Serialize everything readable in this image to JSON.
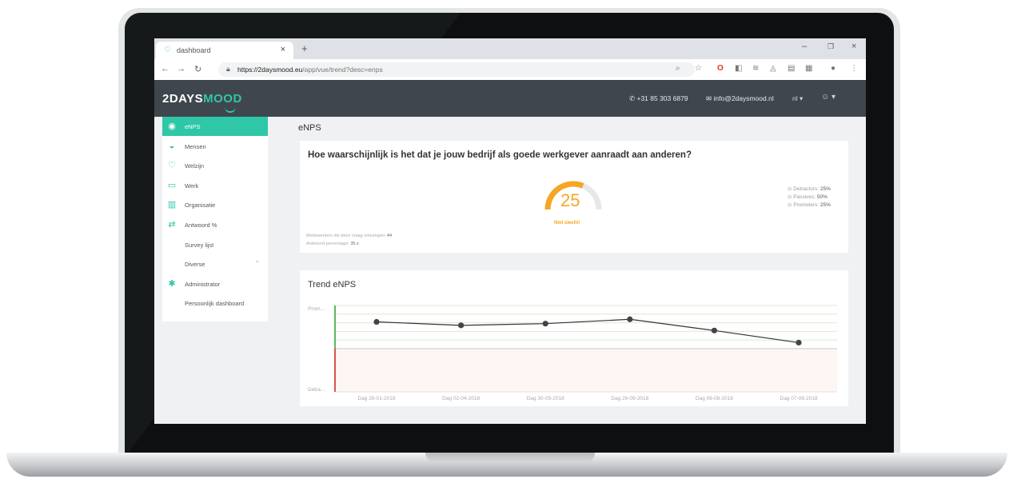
{
  "browser": {
    "tab_title": "dashboard",
    "url_domain": "https://2daysmood.eu",
    "url_path": "/app/vue/trend?desc=enps",
    "new_tab_icon": "plus-icon",
    "controls": [
      "minimize-icon",
      "maximize-icon",
      "close-icon"
    ]
  },
  "header": {
    "logo_a": "2DAYS",
    "logo_b": "MOOD",
    "phone": "+31 85 303 6879",
    "email": "info@2daysmood.nl",
    "lang": "nl",
    "accent": "#2ec7a8",
    "bg": "#40464d"
  },
  "sidebar": {
    "items": [
      {
        "label": "eNPS",
        "icon": "circle-icon",
        "active": true
      },
      {
        "label": "Mensen",
        "icon": "people-icon"
      },
      {
        "label": "Welzijn",
        "icon": "heart-icon"
      },
      {
        "label": "Werk",
        "icon": "briefcase-icon"
      },
      {
        "label": "Organisatie",
        "icon": "building-icon"
      },
      {
        "label": "Antwoord %",
        "icon": "arrows-icon"
      },
      {
        "label": "Survey lijst",
        "icon": ""
      },
      {
        "label": "Diverse",
        "icon": ""
      },
      {
        "label": "Administrator",
        "icon": "gear-icon"
      },
      {
        "label": "Persoonlijk dashboard",
        "icon": ""
      }
    ]
  },
  "main": {
    "page_title": "eNPS",
    "question": "Hoe waarschijnlijk is het dat je jouw bedrijf als goede werkgever aanraadt aan anderen?",
    "score": "25",
    "score_caption": "Niet slecht!",
    "gauge_fraction": 0.625,
    "legend": [
      {
        "label": "Detractors:",
        "value": "25%"
      },
      {
        "label": "Passives:",
        "value": "50%"
      },
      {
        "label": "Promoters:",
        "value": "25%"
      }
    ],
    "stats": [
      {
        "label": "Medewerkers die deze vraag ontvangen:",
        "value": "44"
      },
      {
        "label": "Antwoord percentage:",
        "value": "35.x"
      }
    ],
    "trend_title": "Trend eNPS"
  },
  "chart_data": {
    "type": "line",
    "title": "Trend eNPS",
    "y_tick_labels": [
      "Prom...",
      "Detra..."
    ],
    "x": [
      "Dag 26-01-2018",
      "Dag 02-04-2018",
      "Dag 30-05-2018",
      "Dag 26-09-2018",
      "Dag 06-08-2018",
      "Dag 07-09-2018"
    ],
    "series": [
      {
        "values": [
          0.81,
          0.77,
          0.79,
          0.84,
          0.71,
          0.57
        ]
      }
    ],
    "ylim": [
      0,
      1
    ],
    "colors": {
      "line": "#333333",
      "positive_axis": "#5cb85c",
      "negative_axis": "#d9534f",
      "negative_bg": "#fdf6f4"
    }
  }
}
